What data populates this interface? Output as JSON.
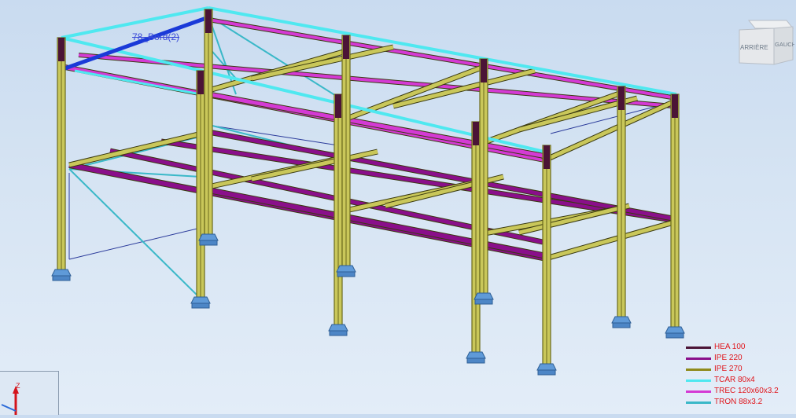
{
  "viewport": {
    "selected_bar_label": "78_Bord(2)",
    "view_cube": {
      "face_back": "ARRIÈRE",
      "face_left": "GAUCHE"
    },
    "axis_label_z": "Z"
  },
  "legend": {
    "text_color": "#e0151b",
    "items": [
      {
        "label": "HEA 100",
        "color": "#4b1436"
      },
      {
        "label": "IPE 220",
        "color": "#8a0f8a"
      },
      {
        "label": "IPE 270",
        "color": "#8f8a1a"
      },
      {
        "label": "TCAR 80x4",
        "color": "#4fe8f0"
      },
      {
        "label": "TREC 120x60x3.2",
        "color": "#d43ad4"
      },
      {
        "label": "TRON 88x3.2",
        "color": "#3ab8c8"
      }
    ]
  },
  "colors": {
    "column": "#c9c75a",
    "column_edge": "#6b6a1c",
    "beam_ipe220": "#8a0f8a",
    "beam_trec": "#d43ad4",
    "beam_tcar": "#4fe8f0",
    "bracing_tron": "#3ab8c8",
    "selected": "#1a3ad8",
    "footing": "#5f9ad8"
  }
}
